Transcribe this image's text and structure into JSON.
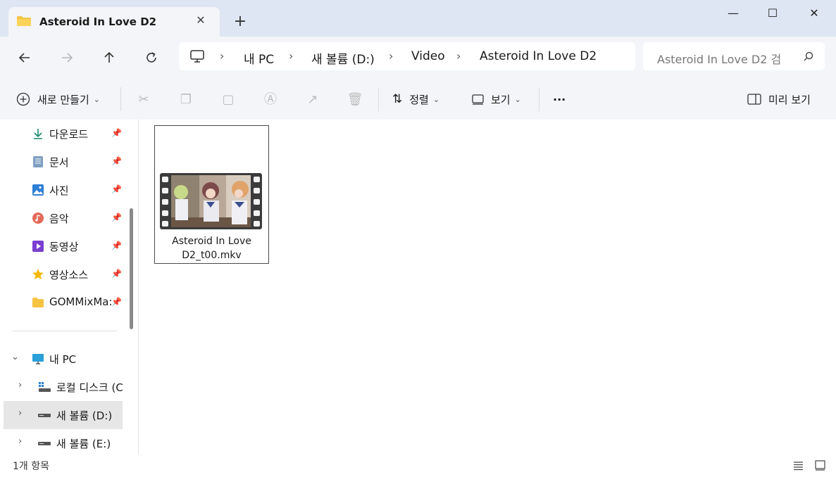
{
  "window": {
    "tab_title": "Asteroid In Love D2",
    "tab_close_label": "✕",
    "new_tab_label": "+",
    "minimize_label": "—",
    "maximize_label": "☐",
    "close_label": "✕"
  },
  "nav": {
    "breadcrumbs": [
      "내 PC",
      "새 볼륨 (D:)",
      "Video",
      "Asteroid In Love D2"
    ],
    "separator": "›",
    "search_placeholder": "Asteroid In Love D2 검"
  },
  "commands": {
    "new_label": "새로 만들기",
    "sort_label": "정렬",
    "view_label": "보기",
    "more_label": "···",
    "preview_label": "미리 보기"
  },
  "sidebar": {
    "quick_access": [
      {
        "label": "다운로드",
        "icon": "download-icon"
      },
      {
        "label": "문서",
        "icon": "document-icon"
      },
      {
        "label": "사진",
        "icon": "pictures-icon"
      },
      {
        "label": "음악",
        "icon": "music-icon"
      },
      {
        "label": "동영상",
        "icon": "video-icon"
      },
      {
        "label": "영상소스",
        "icon": "star-icon"
      },
      {
        "label": "GOMMixMa:",
        "icon": "folder-icon"
      }
    ],
    "tree": [
      {
        "label": "내 PC",
        "icon": "monitor-icon",
        "expander": "⌄"
      },
      {
        "label": "로컬 디스크 (C",
        "icon": "drive-c-icon",
        "expander": "›"
      },
      {
        "label": "새 볼륨 (D:)",
        "icon": "drive-icon",
        "expander": "›",
        "selected": true
      },
      {
        "label": "새 볼륨 (E:)",
        "icon": "drive-icon",
        "expander": "›"
      }
    ]
  },
  "files": [
    {
      "name": "Asteroid In Love D2_t00.mkv",
      "name_line1": "Asteroid In Love",
      "name_line2": "D2_t00.mkv",
      "icon": "video-thumbnail"
    }
  ],
  "status": {
    "item_count": "1개 항목"
  },
  "colors": {
    "titlebar_bg": "#dde6f2",
    "toolbar_bg": "#f3f5f8",
    "selection_bg": "#e6e6e6"
  }
}
